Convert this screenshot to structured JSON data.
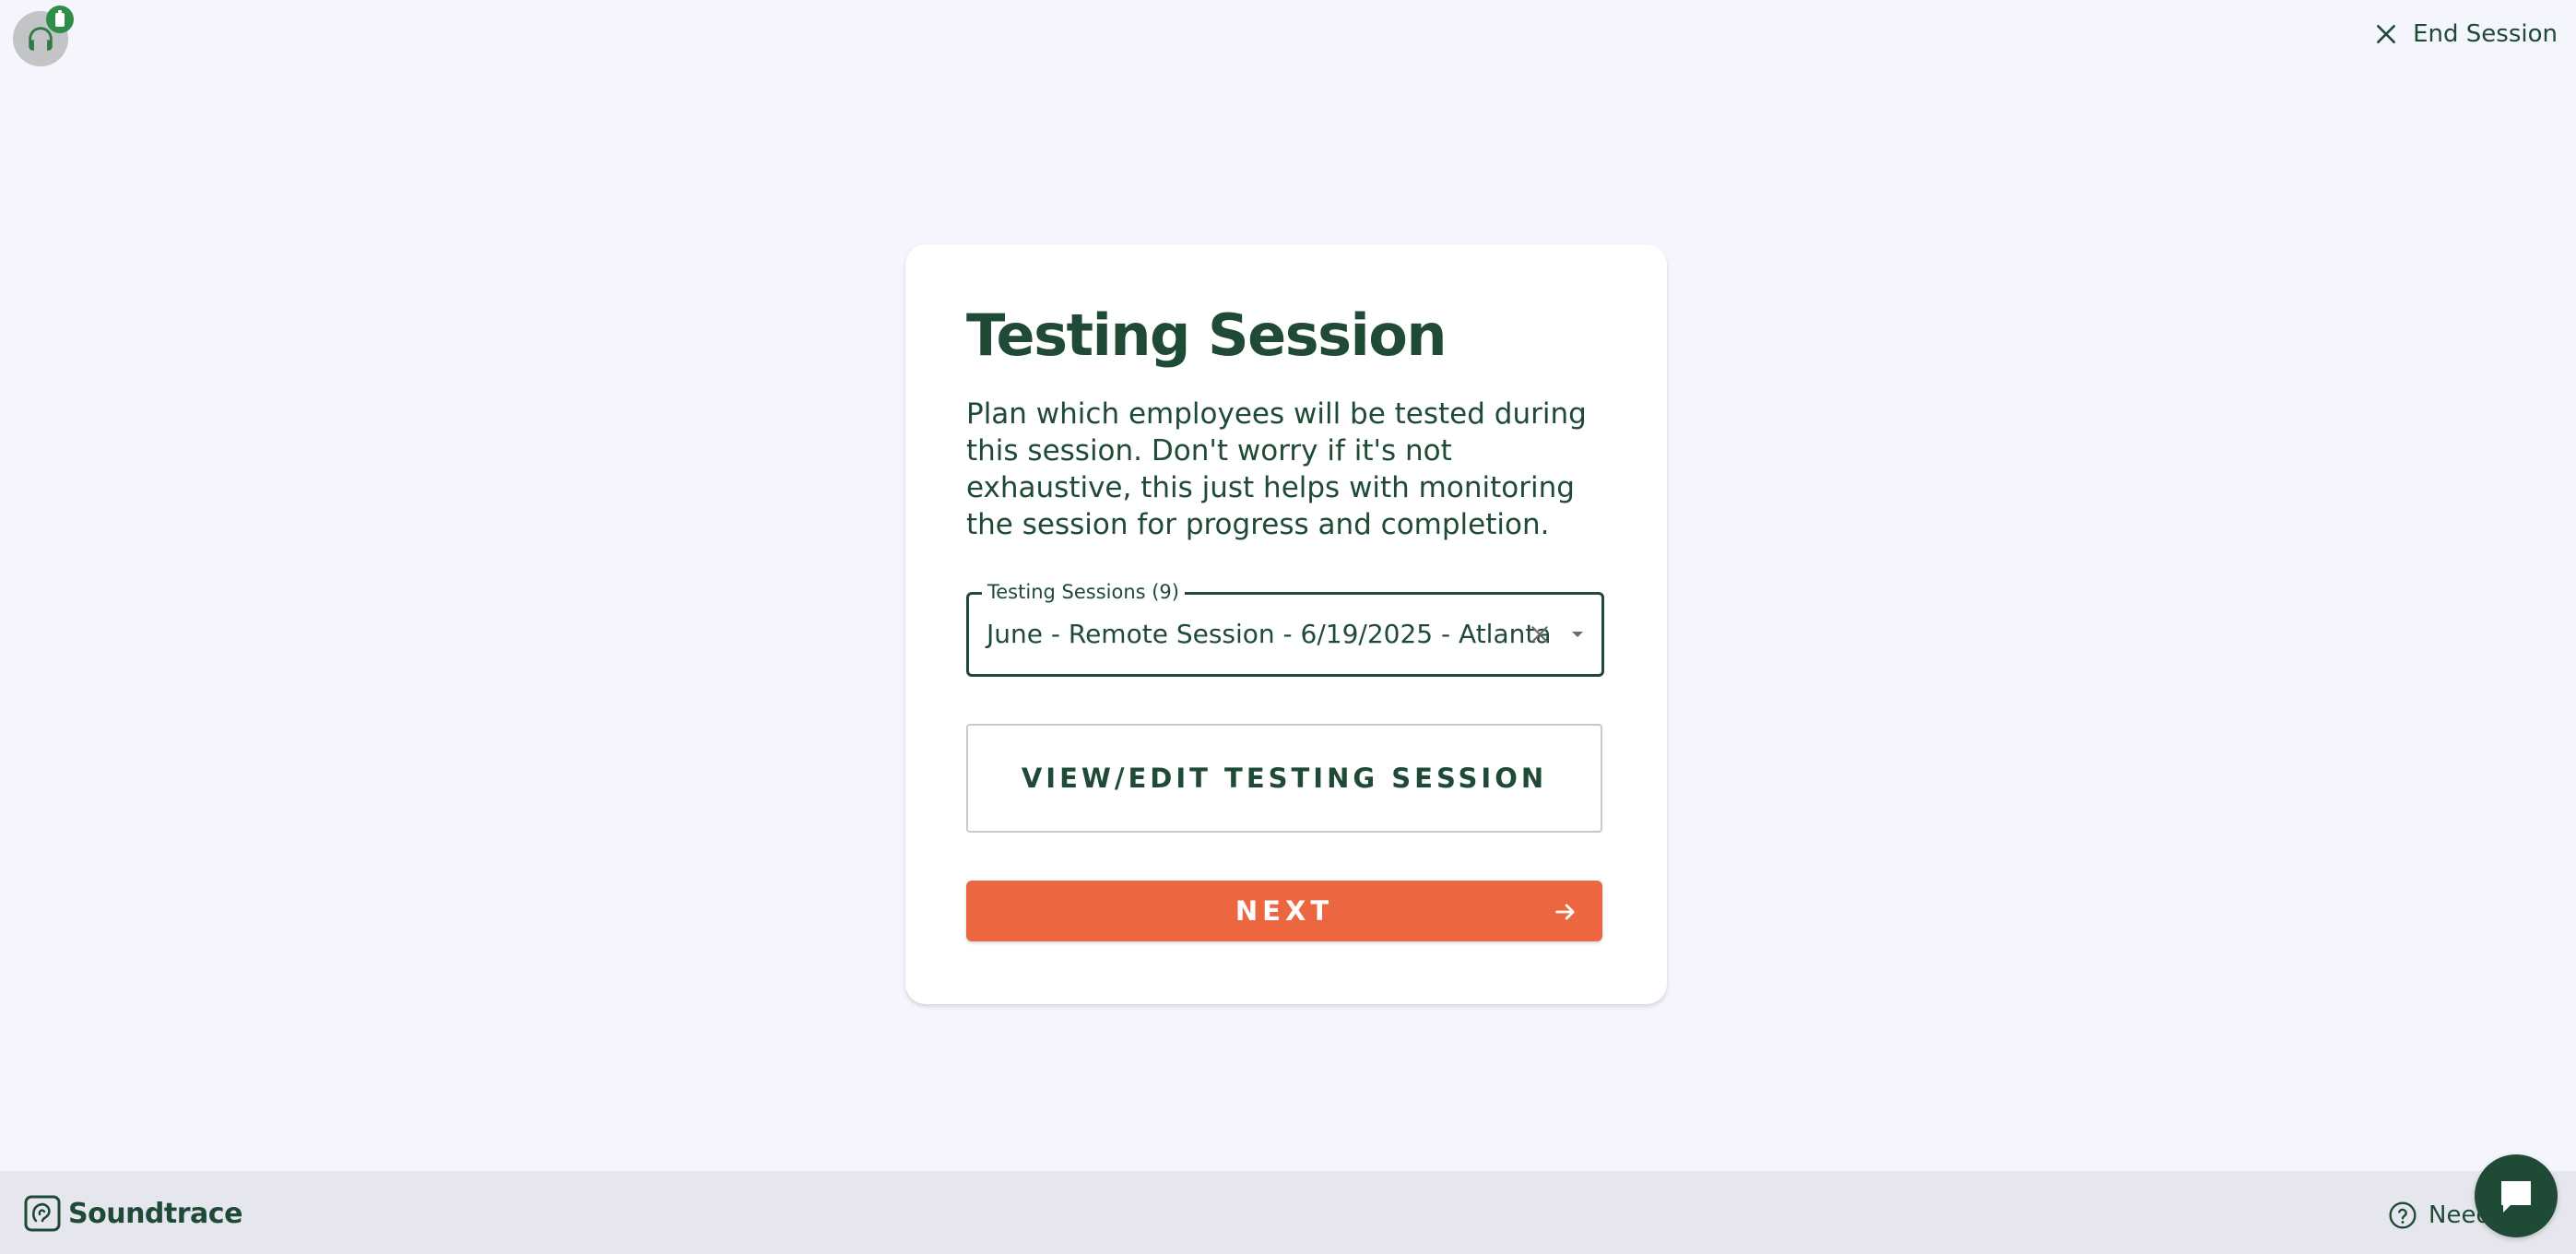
{
  "header": {
    "end_session_label": "End Session",
    "headset_icon": "headset-icon",
    "battery_icon": "battery-icon"
  },
  "card": {
    "title": "Testing Session",
    "description": "Plan which employees will be tested during this session. Don't worry if it's not exhaustive, this just helps with monitoring the session for progress and completion.",
    "select": {
      "label": "Testing Sessions (9)",
      "value": "June - Remote Session - 6/19/2025 - Atlanta"
    },
    "view_edit_label": "VIEW/EDIT TESTING SESSION",
    "next_label": "NEXT"
  },
  "footer": {
    "brand": "Soundtrace",
    "help_label": "Need"
  },
  "colors": {
    "primary": "#1f4a35",
    "accent": "#ec6640",
    "background": "#f4f5fd",
    "status_green": "#2f8d47"
  }
}
